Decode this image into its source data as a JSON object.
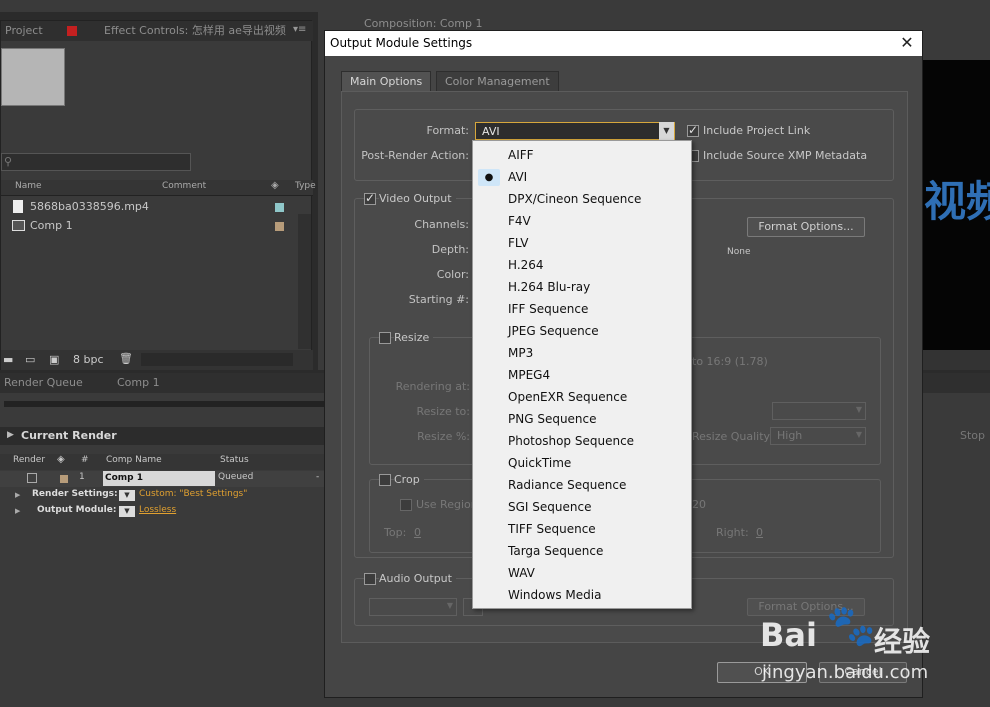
{
  "bg_panels": {
    "project_tab": "Project",
    "effect_controls_tab": "Effect Controls: 怎样用 ae导出视频",
    "composition_tab": "Composition: Comp 1",
    "columns": {
      "name": "Name",
      "comment": "Comment",
      "type": "Type"
    },
    "files": [
      {
        "name": "5868ba0338596.mp4"
      },
      {
        "name": "Comp 1"
      }
    ],
    "bpc": "8 bpc",
    "render_queue_tab": "Render Queue",
    "comp1_tab": "Comp 1",
    "current_render": "Current Render",
    "stop": "Stop",
    "rq_columns": {
      "render": "Render",
      "num": "#",
      "comp_name": "Comp Name",
      "status": "Status"
    },
    "rq_row": {
      "index": "1",
      "comp": "Comp 1",
      "status": "Queued",
      "dash": "-"
    },
    "render_settings_label": "Render Settings:",
    "render_settings_value": "Custom: \"Best Settings\"",
    "output_module_label": "Output Module:",
    "output_module_value": "Lossless",
    "viewer_text": "视频"
  },
  "dialog": {
    "title": "Output Module Settings",
    "close": "✕",
    "tabs": [
      "Main Options",
      "Color Management"
    ],
    "format_label": "Format:",
    "format_value": "AVI",
    "include_project_link": "Include Project Link",
    "post_render_label": "Post-Render Action:",
    "include_xmp": "Include Source XMP Metadata",
    "video_output": "Video Output",
    "channels_label": "Channels:",
    "depth_label": "Depth:",
    "color_label": "Color:",
    "starting_label": "Starting #:",
    "format_options": "Format Options...",
    "none_text": "None",
    "resize": "Resize",
    "to_ratio": "to 16:9 (1.78)",
    "rendering_at": "Rendering at:",
    "resize_to": "Resize to:",
    "resize_pct": "Resize %:",
    "resize_quality": "Resize Quality:",
    "resize_quality_value": "High",
    "crop": "Crop",
    "use_region": "Use Region",
    "region_suffix": "20",
    "top_label": "Top:",
    "top_value": "0",
    "right_label": "Right:",
    "right_value": "0",
    "audio_output": "Audio Output",
    "audio_format_options": "Format Options...",
    "ok": "OK",
    "cancel": "Cancel"
  },
  "format_menu": {
    "selected": "AVI",
    "items": [
      "AIFF",
      "AVI",
      "DPX/Cineon Sequence",
      "F4V",
      "FLV",
      "H.264",
      "H.264 Blu-ray",
      "IFF Sequence",
      "JPEG Sequence",
      "MP3",
      "MPEG4",
      "OpenEXR Sequence",
      "PNG Sequence",
      "Photoshop Sequence",
      "QuickTime",
      "Radiance Sequence",
      "SGI Sequence",
      "TIFF Sequence",
      "Targa Sequence",
      "WAV",
      "Windows Media"
    ]
  },
  "watermark": {
    "brand": "Bai",
    "brand2": "百度",
    "jingyan": "经验",
    "url": "jingyan.baidu.com"
  }
}
